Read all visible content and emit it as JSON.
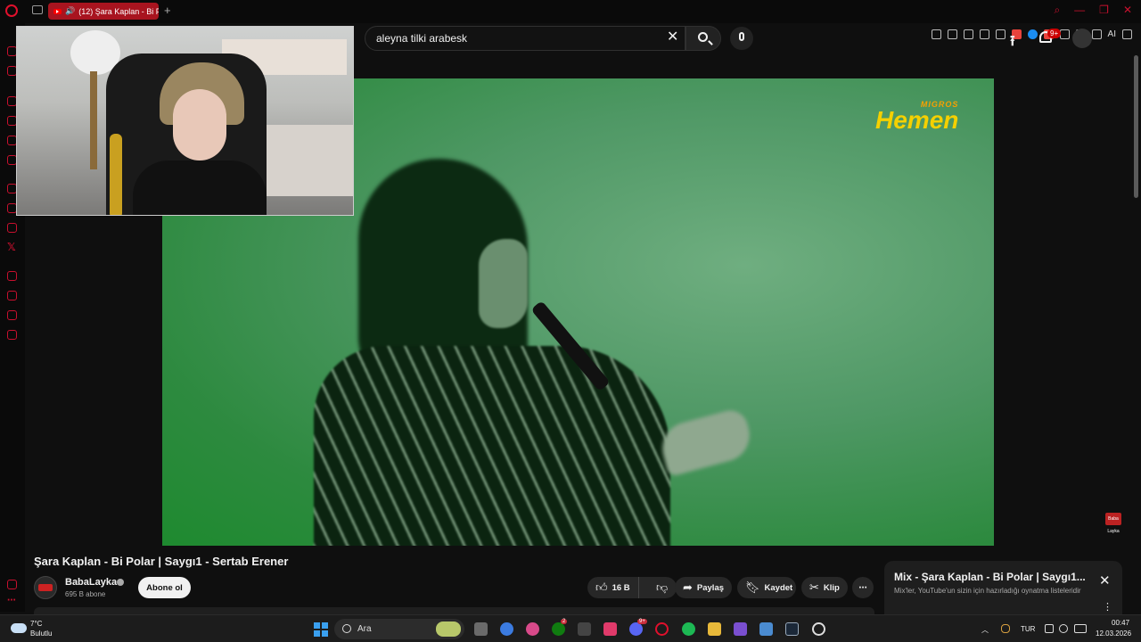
{
  "browser": {
    "tab_title": "(12) Şara Kaplan - Bi P",
    "new_tab_symbol": "+",
    "toolbar_ai_label": "AI"
  },
  "youtube": {
    "search_value": "aleyna tilki arabesk",
    "notification_count": "9+",
    "video": {
      "overlay_brand_small": "MIGROS",
      "overlay_brand_big": "Hemen",
      "corner_logo_text": "Baba Layka",
      "title": "Şara Kaplan - Bi Polar | Saygı1 - Sertab Erener"
    },
    "channel": {
      "name": "BabaLayka",
      "subscribers": "695 B abone",
      "subscribe_label": "Abone ol"
    },
    "actions": {
      "like_count": "16 B",
      "share_label": "Paylaş",
      "save_label": "Kaydet",
      "clip_label": "Klip",
      "more_label": "⋯"
    },
    "mix_panel": {
      "title": "Mix - Şara Kaplan - Bi Polar | Saygı1...",
      "subtitle": "Mix'ler, YouTube'un sizin için hazırladığı oynatma listeleridir",
      "close_label": "✕",
      "more_label": "⋮"
    }
  },
  "taskbar": {
    "weather_temp": "7°C",
    "weather_desc": "Bulutlu",
    "search_placeholder": "Ara",
    "language": "TUR",
    "time": "00:47",
    "date": "12.03.2026",
    "badges": {
      "xbox": "2",
      "discord": "9+"
    }
  },
  "colors": {
    "accent": "#c8102e",
    "youtube_red": "#ff0000",
    "video_green": "#2d8a3f"
  }
}
